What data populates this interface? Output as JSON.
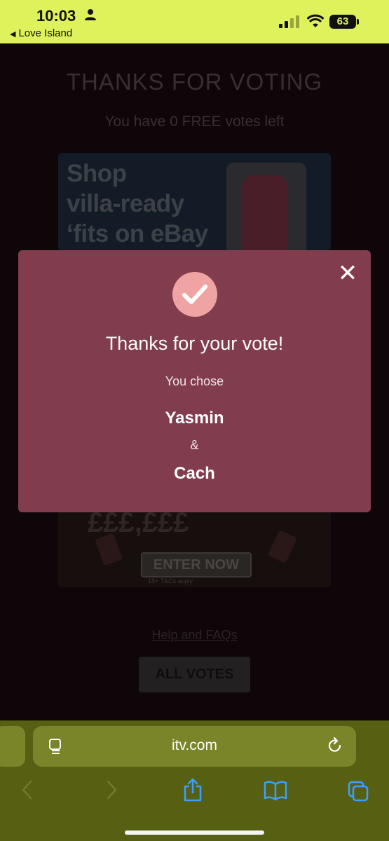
{
  "status_bar": {
    "time": "10:03",
    "back_app": "Love Island",
    "battery": "63"
  },
  "page": {
    "title": "THANKS FOR VOTING",
    "subtitle": "You have 0 FREE votes left",
    "ad_top_lines": [
      "Shop",
      "villa-ready",
      "‘fits on eBay"
    ],
    "ad_bottom_enter": "ENTER NOW",
    "ad_bottom_terms": "18+ T&Cs apply",
    "help_link": "Help and FAQs",
    "all_votes_button": "ALL VOTES"
  },
  "modal": {
    "heading": "Thanks for your vote!",
    "subtext": "You chose",
    "first_choice": "Yasmin",
    "ampersand": "&",
    "second_choice": "Cach",
    "close_icon": "close-icon",
    "check_icon": "check-icon"
  },
  "browser": {
    "url": "itv.com",
    "icons": [
      "page-icon",
      "reload-icon",
      "back-icon",
      "forward-icon",
      "share-icon",
      "bookmarks-icon",
      "tabs-icon"
    ]
  },
  "colors": {
    "status_bar_bg": "#dff25c",
    "modal_bg": "#813d4e",
    "check_circle": "#f0a3a3",
    "browser_bg": "#575f13",
    "browser_accent": "#3aa0ff"
  }
}
